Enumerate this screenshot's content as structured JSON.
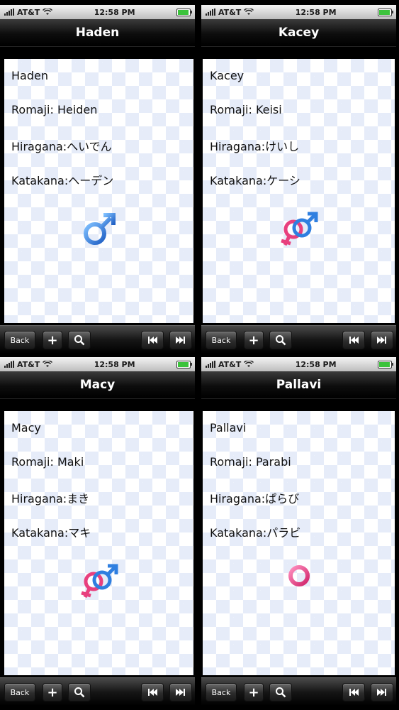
{
  "status": {
    "carrier": "AT&T",
    "time": "12:58 PM"
  },
  "toolbar": {
    "back_label": "Back",
    "plus_label": "+"
  },
  "screens": [
    {
      "title": "Haden",
      "name": "Haden",
      "romaji": "Romaji: Heiden",
      "hiragana": "Hiragana:へいでん",
      "katakana": "Katakana:ヘーデン",
      "gender": "male"
    },
    {
      "title": "Kacey",
      "name": "Kacey",
      "romaji": "Romaji: Keisi",
      "hiragana": "Hiragana:けいし",
      "katakana": "Katakana:ケーシ",
      "gender": "unisex"
    },
    {
      "title": "Macy",
      "name": "Macy",
      "romaji": "Romaji: Maki",
      "hiragana": "Hiragana:まき",
      "katakana": "Katakana:マキ",
      "gender": "unisex"
    },
    {
      "title": "Pallavi",
      "name": "Pallavi",
      "romaji": "Romaji: Parabi",
      "hiragana": "Hiragana:ぱらび",
      "katakana": "Katakana:パラビ",
      "gender": "female"
    }
  ],
  "colors": {
    "male": "#2f7fe0",
    "female": "#e8407e",
    "battery": "#3cc33c"
  }
}
